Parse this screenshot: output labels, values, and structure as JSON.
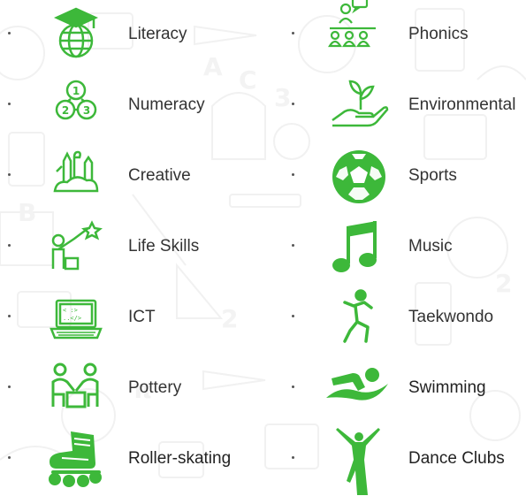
{
  "colors": {
    "accent": "#3db83a",
    "text": "#333333",
    "pattern": "#f0f0f0"
  },
  "activities": {
    "left": [
      {
        "label": "Literacy",
        "icon": "graduation-globe-icon"
      },
      {
        "label": "Numeracy",
        "icon": "numbers-123-icon"
      },
      {
        "label": "Creative",
        "icon": "art-supplies-icon"
      },
      {
        "label": "Life Skills",
        "icon": "teacher-board-icon"
      },
      {
        "label": "ICT",
        "icon": "laptop-code-icon"
      },
      {
        "label": "Pottery",
        "icon": "pottery-people-icon"
      },
      {
        "label": "Roller-skating",
        "icon": "roller-skate-icon"
      }
    ],
    "right": [
      {
        "label": "Phonics",
        "icon": "speaking-group-icon"
      },
      {
        "label": "Environmental",
        "icon": "hand-plant-icon"
      },
      {
        "label": "Sports",
        "icon": "soccer-ball-icon"
      },
      {
        "label": "Music",
        "icon": "music-note-icon"
      },
      {
        "label": "Taekwondo",
        "icon": "martial-arts-icon"
      },
      {
        "label": "Swimming",
        "icon": "swimmer-icon"
      },
      {
        "label": "Dance Clubs",
        "icon": "dancer-icon"
      }
    ]
  }
}
